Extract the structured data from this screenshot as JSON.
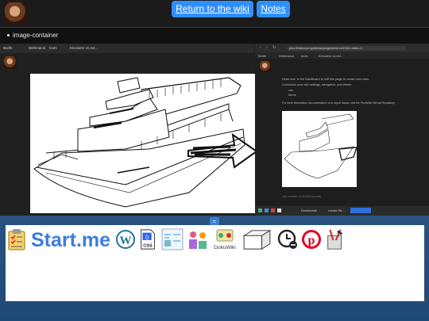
{
  "topbar": {
    "return_label": "Return to the wiki",
    "notes_label": "Notes"
  },
  "bullet": {
    "label": "image-container"
  },
  "left_browser": {
    "bookmarks": [
      "Bxdfe",
      "Webmacst",
      "tools",
      "Klossiers vs ext..."
    ],
    "drawing_caption": "Technical line drawing of a ship"
  },
  "right_browser": {
    "url": "plus.thekeeper.gateway/pagename.net/?pb=index-1",
    "bookmarks": [
      "Bxdfe",
      "Webmacst",
      "tools",
      "Klossiers vs ext..."
    ],
    "lines": [
      "Head over to the Dashboard to edit this page or create new ones.",
      "Customize your wiki settings, navigation, and theme.",
      "css",
      "forms",
      "For more information, documentation, or to report issues, visit the PlumWiki GitHub Repository."
    ],
    "footer": "Last modified: 11.04.2026 by tosss",
    "taskbar_items": [
      "Downloads",
      "roboto PA..."
    ]
  },
  "icons": [
    "clipboard-checklist-icon",
    "startme-logo",
    "wordpress-icon",
    "css-file-icon",
    "jpg-to-html-icon",
    "people-chart-icon",
    "dokuwiki-icon",
    "3d-box-icon",
    "clock-minus-icon",
    "pinterest-icon",
    "tools-icon"
  ],
  "brand": {
    "startme_text": "Start.me",
    "dokuwiki_text": "DokuWiki"
  }
}
